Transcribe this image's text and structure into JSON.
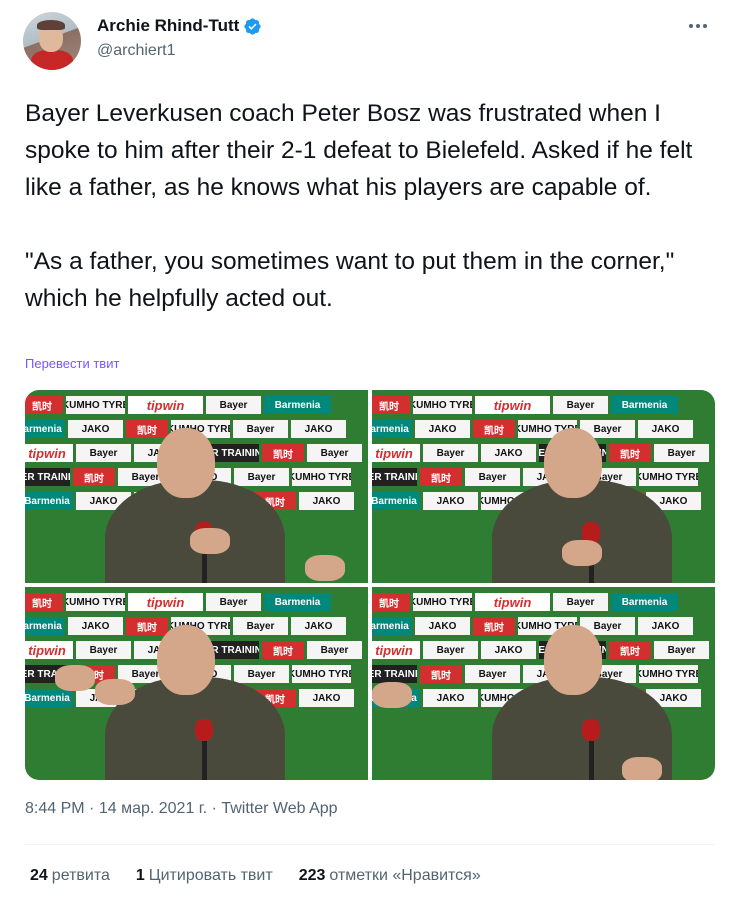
{
  "author": {
    "display_name": "Archie Rhind-Tutt",
    "handle": "@archiert1",
    "verified": true
  },
  "tweet": {
    "paragraphs": [
      "Bayer Leverkusen coach Peter Bosz was frustrated when I spoke to him after their 2-1 defeat to Bielefeld. Asked if he felt like a father, as he knows what his players are capable of.",
      "\"As a father, you sometimes want to put them in the corner,\" which he helpfully acted out."
    ],
    "translate_label": "Перевести твит"
  },
  "media": {
    "panels": 4,
    "sponsor_boards": [
      "KUMHO TYRE",
      "tipwin",
      "Bayer",
      "Barmenia",
      "JAKO",
      "KIESER TRAINING",
      "凯时"
    ]
  },
  "meta": {
    "time": "8:44 PM",
    "date": "14 мар. 2021 г.",
    "source": "Twitter Web App",
    "separator": "·"
  },
  "stats": {
    "retweets_count": "24",
    "retweets_label": "ретвита",
    "quotes_count": "1",
    "quotes_label": "Цитировать твит",
    "likes_count": "223",
    "likes_label": "отметки «Нравится»"
  },
  "colors": {
    "verified": "#1d9bf0",
    "secondary_text": "#536471",
    "translate_link": "#7856ff"
  },
  "icons": {
    "verified": "verified-badge-icon",
    "more": "more-options-icon"
  }
}
